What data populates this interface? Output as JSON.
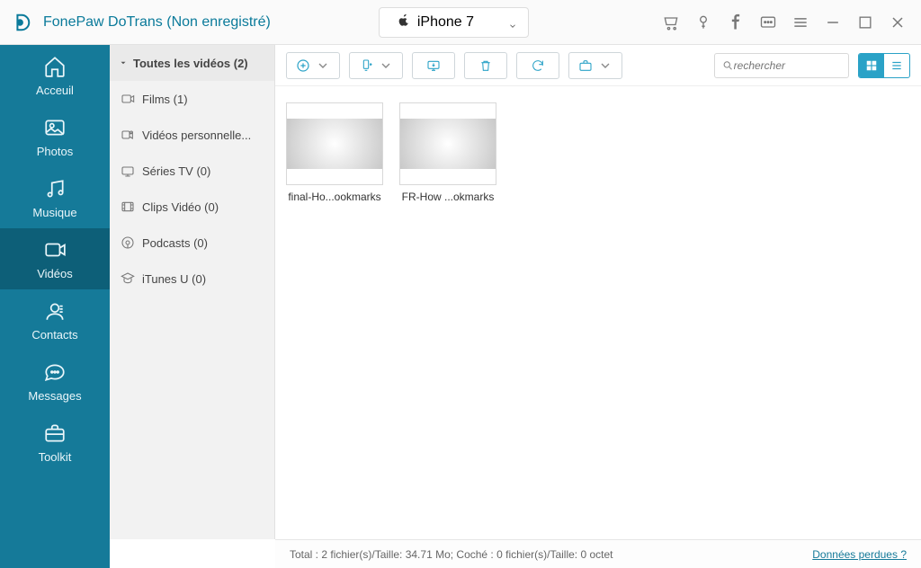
{
  "header": {
    "title": "FonePaw DoTrans (Non enregistré)",
    "device": "iPhone 7"
  },
  "sidebar": {
    "items": [
      {
        "label": "Acceuil"
      },
      {
        "label": "Photos"
      },
      {
        "label": "Musique"
      },
      {
        "label": "Vidéos"
      },
      {
        "label": "Contacts"
      },
      {
        "label": "Messages"
      },
      {
        "label": "Toolkit"
      }
    ],
    "active_index": 3
  },
  "subnav": {
    "header": "Toutes les vidéos (2)",
    "items": [
      {
        "label": "Films (1)"
      },
      {
        "label": "Vidéos personnelle..."
      },
      {
        "label": "Séries TV (0)"
      },
      {
        "label": "Clips Vidéo (0)"
      },
      {
        "label": "Podcasts (0)"
      },
      {
        "label": "iTunes U (0)"
      }
    ]
  },
  "search": {
    "placeholder": "rechercher"
  },
  "grid": {
    "items": [
      {
        "label": "final-Ho...ookmarks"
      },
      {
        "label": "FR-How ...okmarks"
      }
    ]
  },
  "status": {
    "text": "Total : 2 fichier(s)/Taille: 34.71 Mo; Coché : 0 fichier(s)/Taille: 0 octet",
    "link": "Données perdues ?"
  }
}
